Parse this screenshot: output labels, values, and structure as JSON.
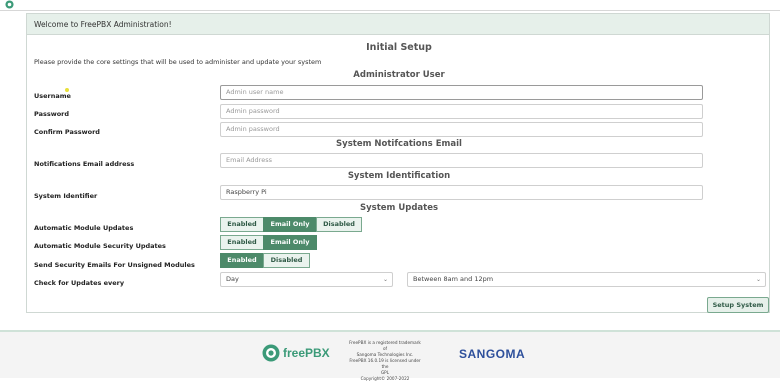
{
  "panel": {
    "header": "Welcome to FreePBX Administration!"
  },
  "setup": {
    "title": "Initial Setup",
    "intro": "Please provide the core settings that will be used to administer and update your system"
  },
  "admin": {
    "heading": "Administrator User",
    "username_label": "Username",
    "username_placeholder": "Admin user name",
    "password_label": "Password",
    "password_placeholder": "Admin password",
    "confirm_label": "Confirm Password",
    "confirm_placeholder": "Admin password"
  },
  "notifications": {
    "heading": "System Notifcations Email",
    "email_label": "Notifications Email address",
    "email_placeholder": "Email Address"
  },
  "identification": {
    "heading": "System Identification",
    "identifier_label": "System Identifier",
    "identifier_value": "Raspberry Pi"
  },
  "updates": {
    "heading": "System Updates",
    "auto_module": {
      "label": "Automatic Module Updates",
      "options": [
        "Enabled",
        "Email Only",
        "Disabled"
      ],
      "selected": "Email Only"
    },
    "auto_security": {
      "label": "Automatic Module Security Updates",
      "options": [
        "Enabled",
        "Email Only"
      ],
      "selected": "Email Only"
    },
    "unsigned": {
      "label": "Send Security Emails For Unsigned Modules",
      "options": [
        "Enabled",
        "Disabled"
      ],
      "selected": "Enabled"
    },
    "check": {
      "label": "Check for Updates every",
      "day": "Day",
      "time": "Between 8am and 12pm"
    }
  },
  "submit_label": "Setup System",
  "footer": {
    "brand": "freePBX",
    "legal": [
      "FreePBX is a registered trademark of",
      "Sangoma Technologies Inc.",
      "FreePBX 16.0.19 is licensed under the",
      "GPL",
      "Copyright© 2007-2022"
    ],
    "sangoma": "SANGOMA"
  },
  "colors": {
    "accent": "#4d8a6a",
    "panel_header": "#e6f0ea",
    "brand_green": "#3b9a78",
    "sangoma_blue": "#2d4f9b"
  },
  "icons": [
    "freepbx-logo-icon",
    "chevron-down-icon"
  ]
}
